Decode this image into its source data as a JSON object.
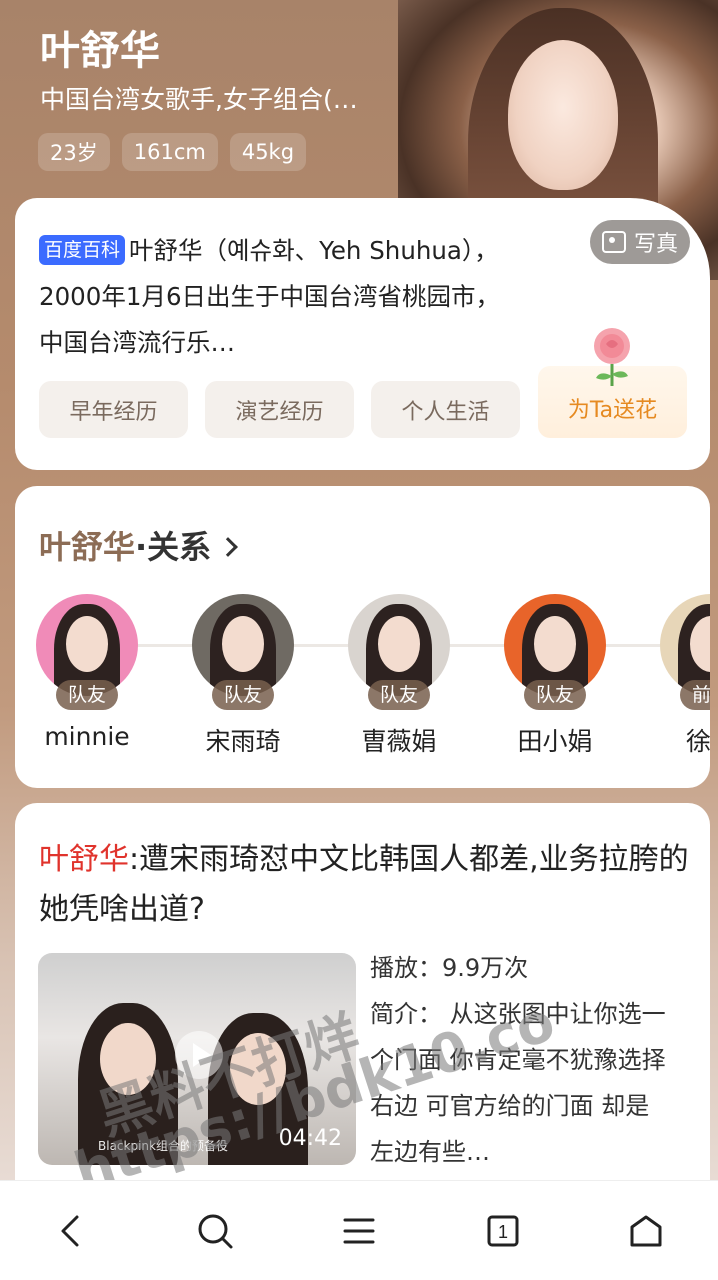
{
  "hero": {
    "name": "叶舒华",
    "subtitle": "中国台湾女歌手,女子组合(…",
    "tags": [
      "23岁",
      "161cm",
      "45kg"
    ],
    "photo_button": "写真"
  },
  "intro": {
    "source_badge": "百度百科",
    "text": "叶舒华（예슈화、Yeh Shuhua），2000年1月6日出生于中国台湾省桃园市，中国台湾流行乐…",
    "chips": [
      "早年经历",
      "演艺经历",
      "个人生活"
    ],
    "flower_button": "为Ta送花"
  },
  "relations": {
    "title_name": "叶舒华",
    "title_sep": "·",
    "title_label": "关系",
    "items": [
      {
        "badge": "队友",
        "name": "minnie",
        "bg": "#f08bb8"
      },
      {
        "badge": "队友",
        "name": "宋雨琦",
        "bg": "#6f6a63"
      },
      {
        "badge": "队友",
        "name": "曺薇娟",
        "bg": "#d9d4cf"
      },
      {
        "badge": "队友",
        "name": "田小娟",
        "bg": "#e8642a"
      },
      {
        "badge": "前队",
        "name": "徐穗",
        "bg": "#e7d6b8"
      }
    ]
  },
  "news": {
    "title_highlight": "叶舒华",
    "title_rest": ":遭宋雨琦怼中文比韩国人都差,业务拉胯的她凭啥出道?",
    "video_caption": "Blackpink组合的预备役",
    "duration": "04:42",
    "plays_label": "播放：",
    "plays_value": "9.9万次",
    "intro_label": "简介：",
    "intro_text": "从这张图中让你选一个门面 你肯定毫不犹豫选择右边 可官方给的门面 却是左边有些…"
  },
  "watermark": {
    "line1": "黑料不打烊",
    "line2": "https://bdk10.co"
  },
  "nav": {
    "tab_count": "1"
  }
}
